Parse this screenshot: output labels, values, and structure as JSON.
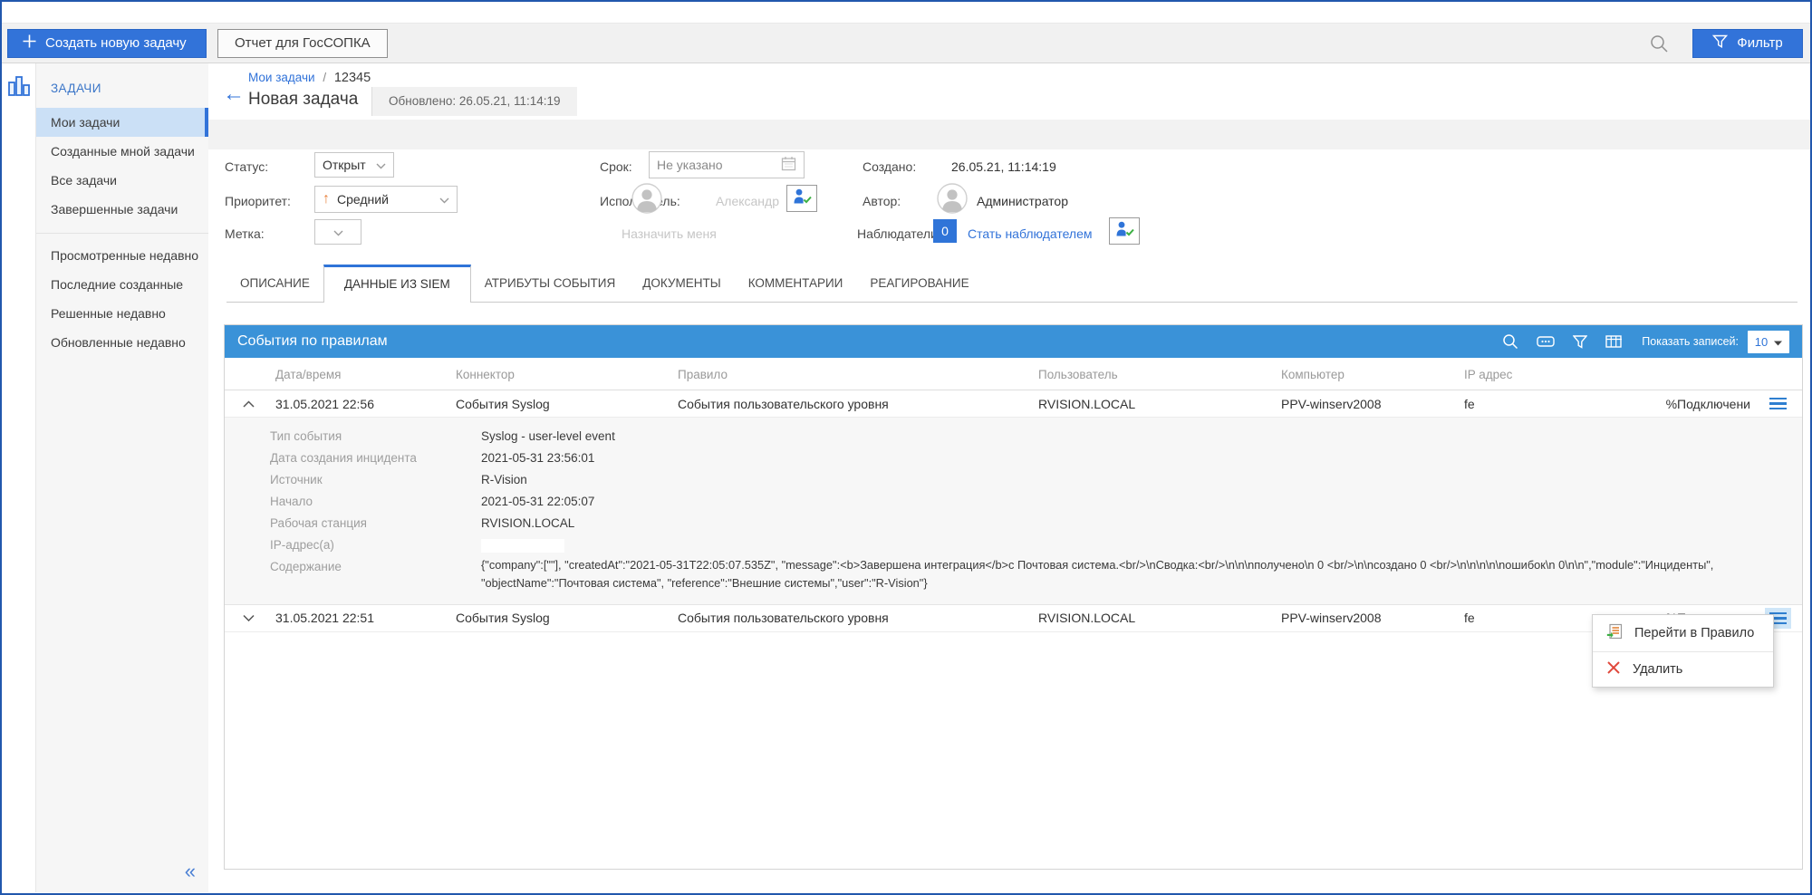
{
  "colors": {
    "accent_blue": "#3273d9",
    "panel_header_blue": "#3a92d8",
    "priority_orange": "#e8803c",
    "delete_red": "#e0483c"
  },
  "topbar": {
    "create_task_label": "Создать новую задачу",
    "report_label": "Отчет для ГосСОПКА",
    "filter_label": "Фильтр"
  },
  "sidebar": {
    "section_title": "ЗАДАЧИ",
    "items": [
      "Мои задачи",
      "Созданные мной задачи",
      "Все задачи",
      "Завершенные задачи"
    ],
    "items_recent": [
      "Просмотренные недавно",
      "Последние созданные",
      "Решенные недавно",
      "Обновленные недавно"
    ],
    "collapse_glyph": "«"
  },
  "header": {
    "back_glyph": "←",
    "breadcrumb_parent": "Мои задачи",
    "breadcrumb_separator": "/",
    "breadcrumb_current": "12345",
    "title": "Новая задача",
    "updated": "Обновлено: 26.05.21, 11:14:19"
  },
  "form": {
    "status_label": "Статус:",
    "status_value": "Открыт",
    "deadline_label": "Срок:",
    "deadline_value": "Не указано",
    "created_label": "Создано:",
    "created_value": "26.05.21, 11:14:19",
    "priority_label": "Приоритет:",
    "priority_arrow": "↑",
    "priority_value": "Средний",
    "assignee_label": "Исполнитель:",
    "assignee_placeholder": "Александр",
    "author_label": "Автор:",
    "author_value": "Администратор",
    "tag_label": "Метка:",
    "assign_me_label": "Назначить меня",
    "watchers_label": "Наблюдатели:",
    "watchers_count": "0",
    "become_watcher_label": "Стать наблюдателем"
  },
  "tabs": [
    {
      "label": "ОПИСАНИЕ",
      "active": false
    },
    {
      "label": "ДАННЫЕ ИЗ SIEM",
      "active": true
    },
    {
      "label": "АТРИБУТЫ СОБЫТИЯ",
      "active": false
    },
    {
      "label": "ДОКУМЕНТЫ",
      "active": false
    },
    {
      "label": "КОММЕНТАРИИ",
      "active": false
    },
    {
      "label": "РЕАГИРОВАНИЕ",
      "active": false
    }
  ],
  "events_panel": {
    "title": "События по правилам",
    "show_records_label": "Показать записей:",
    "show_records_value": "10",
    "columns": [
      "Дата/время",
      "Коннектор",
      "Правило",
      "Пользователь",
      "Компьютер",
      "IP адрес"
    ],
    "rows": [
      {
        "datetime": "31.05.2021 22:56",
        "connector": "События Syslog",
        "rule": "События пользовательского уровня",
        "user": "RVISION.LOCAL",
        "computer": "PPV-winserv2008",
        "ip": "fe",
        "extra": "%Подключени",
        "expanded": true
      },
      {
        "datetime": "31.05.2021 22:51",
        "connector": "События Syslog",
        "rule": "События пользовательского уровня",
        "user": "RVISION.LOCAL",
        "computer": "PPV-winserv2008",
        "ip": "fe",
        "extra": "%Подключени",
        "expanded": false
      }
    ],
    "details": [
      {
        "key": "Тип события",
        "value": "Syslog - user-level event"
      },
      {
        "key": "Дата создания инцидента",
        "value": "2021-05-31 23:56:01"
      },
      {
        "key": "Источник",
        "value": "R-Vision"
      },
      {
        "key": "Начало",
        "value": "2021-05-31 22:05:07"
      },
      {
        "key": "Рабочая станция",
        "value": "RVISION.LOCAL"
      },
      {
        "key": "IP-адрес(а)",
        "value": ""
      },
      {
        "key": "Содержание",
        "value": "{\"company\":[\"\"], \"createdAt\":\"2021-05-31T22:05:07.535Z\", \"message\":<b>Завершена интеграция</b>с Почтовая система.<br/>\\nСводка:<br/>\\n\\n\\nполучено\\n 0 <br/>\\n\\nсоздано 0 <br/>\\n\\n\\n\\n\\nошибок\\n 0\\n\\n\",\"module\":\"Инциденты\", \"objectName\":\"Почтовая система\", \"reference\":\"Внешние системы\",\"user\":\"R-Vision\"}"
      }
    ]
  },
  "context_menu": {
    "items": [
      {
        "label": "Перейти в Правило"
      },
      {
        "label": "Удалить"
      }
    ]
  }
}
